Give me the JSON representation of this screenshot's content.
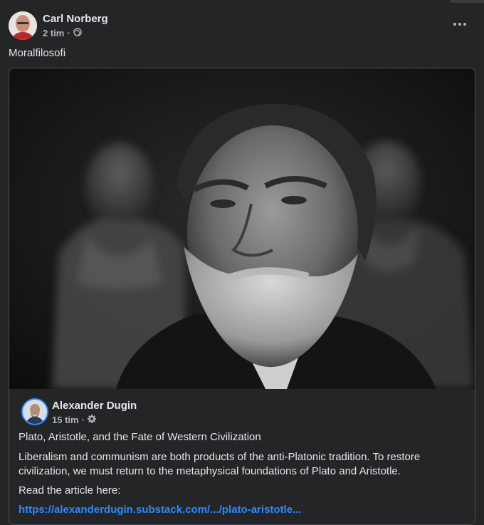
{
  "post": {
    "author": "Carl Norberg",
    "time": "2 tim",
    "separator": "·",
    "audience_icon": "globe-icon",
    "text": "Moralfilosofi"
  },
  "shared": {
    "author": "Alexander Dugin",
    "time": "15 tim",
    "separator": "·",
    "audience_icon": "settings-icon",
    "title": "Plato, Aristotle, and the Fate of Western Civilization",
    "body": "Liberalism and communism are both products of the anti-Platonic tradition. To restore civilization, we must return to the metaphysical foundations of Plato and Aristotle.",
    "read_label": "Read the article here:",
    "link_text": "https://alexanderdugin.substack.com/.../plato-aristotle..."
  },
  "colors": {
    "background": "#242526",
    "text_primary": "#e4e6eb",
    "text_secondary": "#b0b3b8",
    "link": "#2d88ff"
  }
}
